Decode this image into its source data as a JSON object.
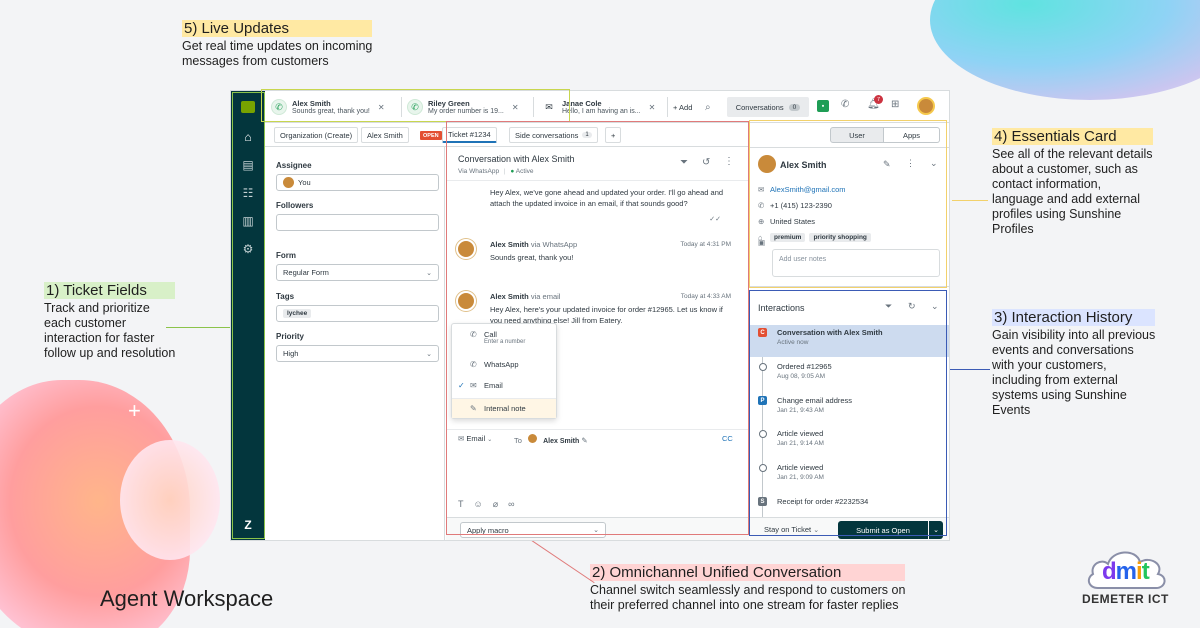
{
  "annotations": {
    "live_updates": {
      "title": "5) Live Updates",
      "desc_1": "Get real time updates on incoming",
      "desc_2": "messages  from customers"
    },
    "ticket_fields": {
      "title": "1) Ticket Fields",
      "desc_1": "Track and prioritize",
      "desc_2": "each customer",
      "desc_3": "interaction for faster",
      "desc_4": "follow up and resolution"
    },
    "essentials": {
      "title": "4) Essentials Card",
      "desc_1": "See all of the relevant details",
      "desc_2": "about a customer, such as",
      "desc_3": "contact information,",
      "desc_4": "language and add external",
      "desc_5": "profiles using Sunshine",
      "desc_6": "Profiles"
    },
    "interaction_history": {
      "title": "3) Interaction History",
      "desc_1": "Gain visibility into all previous",
      "desc_2": "events and conversations",
      "desc_3": "with your customers,",
      "desc_4": "including from external",
      "desc_5": "systems using Sunshine",
      "desc_6": "Events"
    },
    "omnichannel": {
      "title": "2) Omnichannel Unified Conversation",
      "desc_1": "Channel switch seamlessly and respond to customers on",
      "desc_2": "their preferred channel  into one stream for faster replies"
    }
  },
  "page_title": "Agent Workspace",
  "brand": {
    "name": "dmit",
    "subtitle": "DEMETER ICT"
  },
  "colors": {
    "nav_bg": "#03363d",
    "accent_green": "#78a300",
    "live_box": "#c8d64f",
    "ticket_box": "#8bc34a",
    "convo_box": "#e07a7a",
    "essentials_box": "#f2d16b",
    "history_box": "#3b5bb5"
  },
  "topbar": {
    "tabs": [
      {
        "name": "Alex Smith",
        "message": "Sounds great, thank you!",
        "icon": "whatsapp-icon"
      },
      {
        "name": "Riley Green",
        "message": "My order number is 19...",
        "icon": "whatsapp-icon"
      },
      {
        "name": "Janae Cole",
        "message": "Hello, I am having an is...",
        "icon": "mail-icon"
      }
    ],
    "add_label": "+ Add",
    "conversations_label": "Conversations",
    "conversations_count": "0",
    "notification_count": "7"
  },
  "subbar": {
    "org_label": "Organization (Create)",
    "user_label": "Alex Smith",
    "status_badge": "OPEN",
    "ticket_label": "Ticket #1234",
    "side_convos_label": "Side conversations",
    "side_convos_count": "1",
    "plus": "+"
  },
  "ticket_fields": {
    "assignee_label": "Assignee",
    "assignee_value": "You",
    "followers_label": "Followers",
    "form_label": "Form",
    "form_value": "Regular Form",
    "tags_label": "Tags",
    "tag_value": "lychee",
    "priority_label": "Priority",
    "priority_value": "High"
  },
  "conversation": {
    "title": "Conversation with Alex Smith",
    "via": "Via WhatsApp",
    "status": "Active",
    "messages": [
      {
        "body": "Hey Alex, we've gone ahead and updated your order. I'll go ahead and attach the updated invoice in an email, if that sounds good?"
      },
      {
        "who": "Alex Smith",
        "via": "via WhatsApp",
        "time": "Today at 4:31 PM",
        "body": "Sounds great, thank you!"
      },
      {
        "who": "Alex Smith",
        "via": "via email",
        "time": "Today at 4:33 AM",
        "body": "Hey Alex, here's your updated invoice for order #12965. Let us know if you need anything else! Jill from Eatery."
      }
    ],
    "channel_menu": {
      "call": "Call",
      "call_sub": "Enter a number",
      "whatsapp": "WhatsApp",
      "email": "Email",
      "internal_note": "Internal note"
    },
    "composer": {
      "channel": "Email",
      "to_label": "To",
      "to_value": "Alex Smith",
      "cc": "CC"
    },
    "macro_label": "Apply macro"
  },
  "essentials": {
    "user_tab": "User",
    "apps_tab": "Apps",
    "name": "Alex Smith",
    "email": "AlexSmith@gmail.com",
    "phone": "+1 (415) 123-2390",
    "country": "United States",
    "tags": [
      "premium",
      "priority shopping"
    ],
    "notes_placeholder": "Add user notes"
  },
  "interactions": {
    "title": "Interactions",
    "items": [
      {
        "title": "Conversation with Alex Smith",
        "sub": "Active now",
        "type": "ticket"
      },
      {
        "title": "Ordered #12965",
        "sub": "Aug 08, 9:05 AM",
        "type": "event"
      },
      {
        "title": "Change email address",
        "sub": "Jan 21, 9:43 AM",
        "type": "p"
      },
      {
        "title": "Article viewed",
        "sub": "Jan 21, 9:14 AM",
        "type": "event"
      },
      {
        "title": "Article viewed",
        "sub": "Jan 21, 9:09 AM",
        "type": "event"
      },
      {
        "title": "Receipt for order #2232534",
        "sub": "",
        "type": "s"
      }
    ],
    "stay_label": "Stay on Ticket",
    "submit_label": "Submit as Open"
  }
}
